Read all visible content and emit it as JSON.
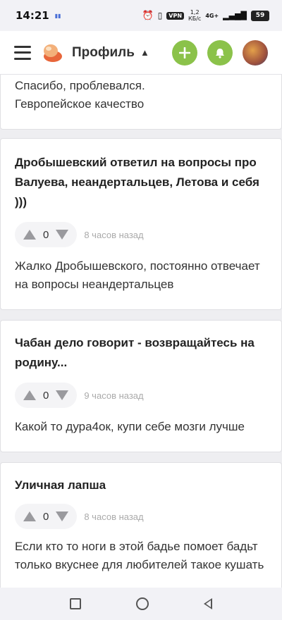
{
  "status": {
    "time": "14:21",
    "vpn": "VPN",
    "speed_value": "1,2",
    "speed_unit": "КБ/с",
    "network": "4G+",
    "battery": "59"
  },
  "header": {
    "title": "Профиль",
    "colors": {
      "accent": "#8bc24a"
    }
  },
  "posts": [
    {
      "title": "",
      "text": "Спасибо, проблевался.\nГевропейское качество"
    },
    {
      "title": "Дробышевский ответил на вопросы про Валуева, неандертальцев, Летова и себя )))",
      "votes": "0",
      "time": "8 часов назад",
      "text": "Жалко Дробышевского, постоянно отвечает на вопросы неандертальцев"
    },
    {
      "title": "Чабан дело говорит - возвращайтесь на родину...",
      "votes": "0",
      "time": "9 часов назад",
      "text": "Какой то дура4ок, купи себе мозги лучше"
    },
    {
      "title": "Уличная лапша",
      "votes": "0",
      "time": "8 часов назад",
      "text": "Если кто то ноги в этой бадье помоет бадьт только вкуснее для любителей такое кушать"
    }
  ]
}
